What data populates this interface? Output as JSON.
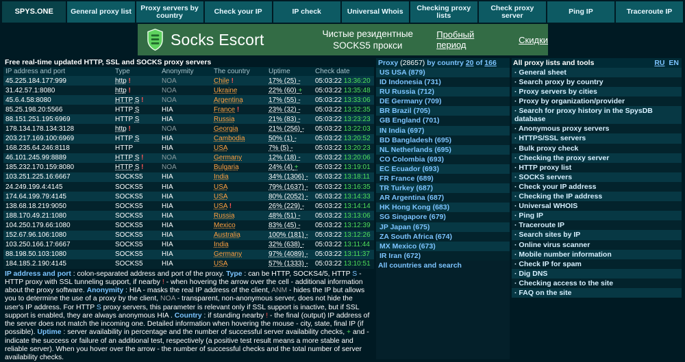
{
  "nav": [
    {
      "label": "SPYS.ONE",
      "name": "nav-home"
    },
    {
      "label": "General proxy list",
      "name": "nav-general-proxy-list"
    },
    {
      "label": "Proxy servers by country",
      "name": "nav-proxy-by-country"
    },
    {
      "label": "Check your IP",
      "name": "nav-check-your-ip"
    },
    {
      "label": "IP check",
      "name": "nav-ip-check"
    },
    {
      "label": "Universal Whois",
      "name": "nav-universal-whois"
    },
    {
      "label": "Checking proxy lists",
      "name": "nav-checking-proxy-lists"
    },
    {
      "label": "Check proxy server",
      "name": "nav-check-proxy-server"
    },
    {
      "label": "Ping IP",
      "name": "nav-ping-ip"
    },
    {
      "label": "Traceroute IP",
      "name": "nav-traceroute-ip"
    }
  ],
  "banner": {
    "brand": "Socks Escort",
    "tagline_1": "Чистые резидентные",
    "tagline_2": "SOCKS5 прокси",
    "trial": "Пробный период",
    "discounts": "Скидки",
    "accent": "#336c45"
  },
  "proxy_list": {
    "title": "Free real-time updated HTTP, SSL and SOCKS proxy servers",
    "headers": [
      "IP address and port",
      "Type",
      "Anonymity",
      "The country",
      "Uptime",
      "Check date"
    ],
    "rows": [
      {
        "ip": "45.225.184.177:999",
        "type": "http",
        "type_s": "",
        "type_excl": "!",
        "anon": "NOA",
        "country": "Chile",
        "country_excl": "!",
        "uptime": "17% (25)",
        "uptime_mark": "-",
        "date": "05:03:22",
        "time": "13:36:20"
      },
      {
        "ip": "31.42.57.1:8080",
        "type": "http",
        "type_s": "",
        "type_excl": "!",
        "anon": "NOA",
        "country": "Ukraine",
        "country_excl": "",
        "uptime": "22% (60)",
        "uptime_mark": "+",
        "date": "05:03:22",
        "time": "13:35:48"
      },
      {
        "ip": "45.6.4.58:8080",
        "type": "HTTP",
        "type_s": "S",
        "type_excl": "!",
        "anon": "NOA",
        "country": "Argentina",
        "country_excl": "",
        "uptime": "17% (55)",
        "uptime_mark": "-",
        "date": "05:03:22",
        "time": "13:33:06"
      },
      {
        "ip": "85.25.198.20:5566",
        "type": "HTTP",
        "type_s": "S",
        "type_excl": "",
        "anon": "HIA",
        "country": "France",
        "country_excl": "!",
        "uptime": "23% (32)",
        "uptime_mark": "-",
        "date": "05:03:22",
        "time": "13:32:35"
      },
      {
        "ip": "88.151.251.195:6969",
        "type": "HTTP",
        "type_s": "S",
        "type_excl": "",
        "anon": "HIA",
        "country": "Russia",
        "country_excl": "",
        "uptime": "21% (83)",
        "uptime_mark": "-",
        "date": "05:03:22",
        "time": "13:23:23"
      },
      {
        "ip": "178.134.178.134:3128",
        "type": "http",
        "type_s": "",
        "type_excl": "!",
        "anon": "NOA",
        "country": "Georgia",
        "country_excl": "",
        "uptime": "21% (256)",
        "uptime_mark": "-",
        "date": "05:03:22",
        "time": "13:22:03"
      },
      {
        "ip": "203.217.169.100:6969",
        "type": "HTTP",
        "type_s": "S",
        "type_excl": "",
        "anon": "HIA",
        "country": "Cambodia",
        "country_excl": "",
        "uptime": "50% (1)",
        "uptime_mark": "-",
        "date": "05:03:22",
        "time": "13:20:52"
      },
      {
        "ip": "168.235.64.246:8118",
        "type": "HTTP",
        "type_s": "",
        "type_excl": "",
        "anon": "HIA",
        "country": "USA",
        "country_excl": "",
        "uptime": "7% (5)",
        "uptime_mark": "-",
        "date": "05:03:22",
        "time": "13:20:23"
      },
      {
        "ip": "46.101.245.99:8889",
        "type": "HTTP",
        "type_s": "S",
        "type_excl": "!",
        "anon": "NOA",
        "country": "Germany",
        "country_excl": "",
        "uptime": "12% (18)",
        "uptime_mark": "-",
        "date": "05:03:22",
        "time": "13:20:06"
      },
      {
        "ip": "185.232.170.159:8080",
        "type": "HTTP",
        "type_s": "S",
        "type_excl": "!",
        "anon": "NOA",
        "country": "Bulgaria",
        "country_excl": "",
        "uptime": "24% (4)",
        "uptime_mark": "+",
        "date": "05:03:22",
        "time": "13:19:01"
      },
      {
        "ip": "103.251.225.16:6667",
        "type": "SOCKS5",
        "type_s": "",
        "type_excl": "",
        "anon": "HIA",
        "country": "India",
        "country_excl": "",
        "uptime": "34% (1306)",
        "uptime_mark": "-",
        "date": "05:03:22",
        "time": "13:18:11"
      },
      {
        "ip": "24.249.199.4:4145",
        "type": "SOCKS5",
        "type_s": "",
        "type_excl": "",
        "anon": "HIA",
        "country": "USA",
        "country_excl": "",
        "uptime": "79% (1637)",
        "uptime_mark": "-",
        "date": "05:03:22",
        "time": "13:16:35"
      },
      {
        "ip": "174.64.199.79:4145",
        "type": "SOCKS5",
        "type_s": "",
        "type_excl": "",
        "anon": "HIA",
        "country": "USA",
        "country_excl": "",
        "uptime": "80% (2052)",
        "uptime_mark": "-",
        "date": "05:03:22",
        "time": "13:14:33"
      },
      {
        "ip": "138.68.18.219:9050",
        "type": "SOCKS5",
        "type_s": "",
        "type_excl": "",
        "anon": "HIA",
        "country": "USA",
        "country_excl": "!",
        "uptime": "26% (229)",
        "uptime_mark": "-",
        "date": "05:03:22",
        "time": "13:14:14"
      },
      {
        "ip": "188.170.49.21:1080",
        "type": "SOCKS5",
        "type_s": "",
        "type_excl": "",
        "anon": "HIA",
        "country": "Russia",
        "country_excl": "",
        "uptime": "48% (51)",
        "uptime_mark": "-",
        "date": "05:03:22",
        "time": "13:13:06"
      },
      {
        "ip": "104.250.179.66:1080",
        "type": "SOCKS5",
        "type_s": "",
        "type_excl": "",
        "anon": "HIA",
        "country": "Mexico",
        "country_excl": "",
        "uptime": "83% (45)",
        "uptime_mark": "-",
        "date": "05:03:22",
        "time": "13:12:39"
      },
      {
        "ip": "152.67.96.106:1080",
        "type": "SOCKS5",
        "type_s": "",
        "type_excl": "",
        "anon": "HIA",
        "country": "Australia",
        "country_excl": "",
        "uptime": "100% (181)",
        "uptime_mark": "-",
        "date": "05:03:22",
        "time": "13:12:26"
      },
      {
        "ip": "103.250.166.17:6667",
        "type": "SOCKS5",
        "type_s": "",
        "type_excl": "",
        "anon": "HIA",
        "country": "India",
        "country_excl": "",
        "uptime": "32% (638)",
        "uptime_mark": "-",
        "date": "05:03:22",
        "time": "13:11:44"
      },
      {
        "ip": "88.198.50.103:1080",
        "type": "SOCKS5",
        "type_s": "",
        "type_excl": "",
        "anon": "HIA",
        "country": "Germany",
        "country_excl": "",
        "uptime": "97% (4089)",
        "uptime_mark": "-",
        "date": "05:03:22",
        "time": "13:11:37"
      },
      {
        "ip": "184.185.2.190:4145",
        "type": "SOCKS5",
        "type_s": "",
        "type_excl": "",
        "anon": "HIA",
        "country": "USA",
        "country_excl": "",
        "uptime": "57% (1333)",
        "uptime_mark": "-",
        "date": "05:03:22",
        "time": "13:10:51"
      }
    ]
  },
  "legend": {
    "k_ip": "IP address and port",
    "t_ip": " : colon-separated address and port of the proxy. ",
    "k_type": "Type",
    "t_type1": " : can be HTTP, SOCKS4/5, HTTP ",
    "s": "S",
    "t_type2": " - HTTP proxy with SSL tunneling support, if nearby ",
    "excl": "!",
    "t_type3": " - when hovering the arrow over the cell - additional information about the proxy software. ",
    "k_anon": "Anonymity",
    "t_anon1": " : HIA - masks the real IP address of the client, ",
    "anm": "ANM",
    "t_anon2": " - hides the IP but allows you to determine the use of a proxy by the client, ",
    "noa": "NOA",
    "t_anon3": " - transparent, non-anonymous server, does not hide the user's IP address. For HTTP ",
    "s2": "S",
    "t_anon4": " proxy servers, this parameter is relevant only if SSL support is inactive, but if SSL support is enabled, they are always anonymous HIA . ",
    "k_country": "Country",
    "t_country1": " : if standing nearby ",
    "excl2": "!",
    "t_country2": " - the final (output) IP address of the server does not match the incoming one. Detailed information when hovering the mouse - city, state, final IP (if possible). ",
    "k_uptime": "Uptime",
    "t_uptime1": " : server availability in percentage and the number of successful server availability checks, ",
    "plus": "+",
    "t_uptime2": " and ",
    "minus": "-",
    "t_uptime3": " indicate the success or failure of an additional test, respectively (a positive test result means a more stable and reliable server). When you hover over the arrow - the number of successful checks and the total number of server availability checks."
  },
  "countries": {
    "label": "Proxy",
    "total": "(28657)",
    "by_country": "by country",
    "shown": "20",
    "of": "of",
    "pages": "166",
    "items": [
      {
        "code": "US",
        "name": "USA",
        "count": "(879)"
      },
      {
        "code": "ID",
        "name": "Indonesia",
        "count": "(731)"
      },
      {
        "code": "RU",
        "name": "Russia",
        "count": "(712)"
      },
      {
        "code": "DE",
        "name": "Germany",
        "count": "(709)"
      },
      {
        "code": "BR",
        "name": "Brazil",
        "count": "(705)"
      },
      {
        "code": "GB",
        "name": "England",
        "count": "(701)"
      },
      {
        "code": "IN",
        "name": "India",
        "count": "(697)"
      },
      {
        "code": "BD",
        "name": "Bangladesh",
        "count": "(695)"
      },
      {
        "code": "NL",
        "name": "Netherlands",
        "count": "(695)"
      },
      {
        "code": "CO",
        "name": "Colombia",
        "count": "(693)"
      },
      {
        "code": "EC",
        "name": "Ecuador",
        "count": "(693)"
      },
      {
        "code": "FR",
        "name": "France",
        "count": "(689)"
      },
      {
        "code": "TR",
        "name": "Turkey",
        "count": "(687)"
      },
      {
        "code": "AR",
        "name": "Argentina",
        "count": "(687)"
      },
      {
        "code": "HK",
        "name": "Hong Kong",
        "count": "(683)"
      },
      {
        "code": "SG",
        "name": "Singapore",
        "count": "(679)"
      },
      {
        "code": "JP",
        "name": "Japan",
        "count": "(675)"
      },
      {
        "code": "ZA",
        "name": "South Africa",
        "count": "(674)"
      },
      {
        "code": "MX",
        "name": "Mexico",
        "count": "(673)"
      },
      {
        "code": "IR",
        "name": "Iran",
        "count": "(672)"
      }
    ],
    "all_link": "All countries and search"
  },
  "tools": {
    "title": "All proxy lists and tools",
    "lang_ru": "RU",
    "lang_en": "EN",
    "links": [
      "General sheet",
      "Search proxy by country",
      "Proxy servers by cities",
      "Proxy by organization/provider",
      "Search for proxy history in the SpysDB database",
      "Anonymous proxy servers",
      "HTTPS/SSL servers",
      "Bulk proxy check",
      "Checking the proxy server",
      "HTTP proxy list",
      "SOCKS servers",
      "Check your IP address",
      "Checking the IP address",
      "Universal WHOIS",
      "Ping IP",
      "Traceroute IP",
      "Search sites by IP",
      "Online virus scanner",
      "Mobile number information",
      "Check IP for spam",
      "Dig DNS",
      "Checking access to the site",
      "FAQ on the site"
    ],
    "bullet": "· "
  }
}
